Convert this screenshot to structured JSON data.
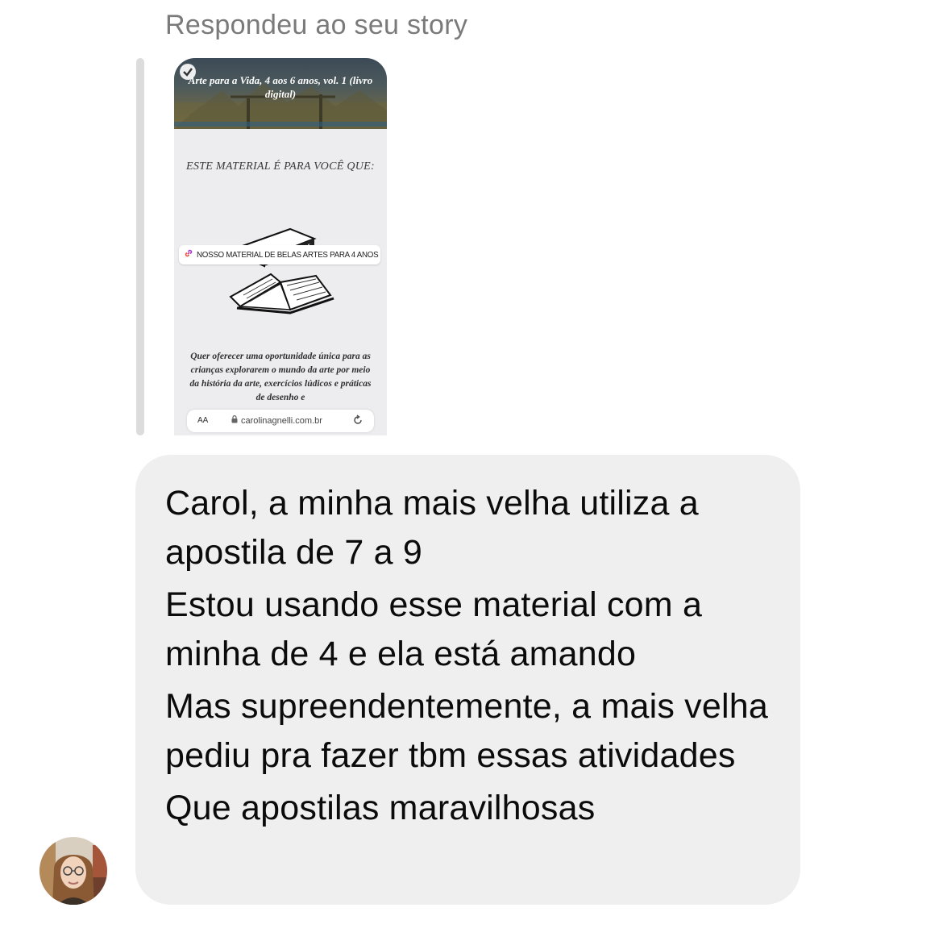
{
  "reply_label": "Respondeu ao seu story",
  "story": {
    "title": "Arte para a Vida, 4 aos 6 anos, vol. 1 (livro digital)",
    "heading": "ESTE MATERIAL É PARA VOCÊ QUE:",
    "link_sticker": "NOSSO MATERIAL DE BELAS ARTES PARA 4 ANOS",
    "paragraph": "Quer oferecer uma oportunidade única para as crianças explorarem o mundo da arte por meio da história da arte, exercícios lúdicos e práticas de desenho e",
    "browser": {
      "aa": "AA",
      "url": "carolinagnelli.com.br"
    }
  },
  "message": {
    "lines": [
      "Carol, a minha mais velha utiliza a apostila de 7 a 9",
      "Estou usando esse material com a minha de 4 e ela está amando",
      "Mas supreendentemente, a mais velha pediu pra fazer tbm essas atividades",
      "Que apostilas maravilhosas"
    ]
  },
  "icons": {
    "check": "check-icon",
    "link": "link-icon",
    "lock": "lock-icon",
    "reload": "reload-icon",
    "books": "books-icon"
  }
}
